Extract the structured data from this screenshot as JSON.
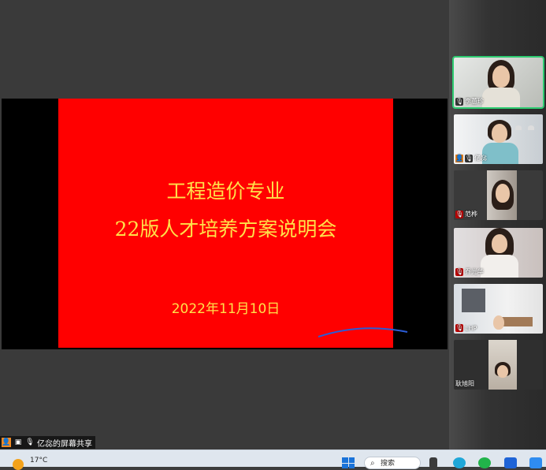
{
  "slide": {
    "title_line1": "工程造价专业",
    "title_line2": "22版人才培养方案说明会",
    "date": "2022年11月10日"
  },
  "participants": [
    {
      "name": "李蕙珍",
      "muted": false,
      "host": false,
      "active": true
    },
    {
      "name": "亿惢",
      "muted": false,
      "host": true,
      "active": false
    },
    {
      "name": "范桦",
      "muted": true,
      "host": false,
      "active": false
    },
    {
      "name": "乔光华",
      "muted": true,
      "host": false,
      "active": false
    },
    {
      "name": "LHP",
      "muted": true,
      "host": false,
      "active": false
    },
    {
      "name": "耿旭阳",
      "muted": false,
      "host": false,
      "active": false
    }
  ],
  "share_status": "亿惢的屏幕共享",
  "taskbar": {
    "temperature": "17°C",
    "search_label": "搜索"
  },
  "colors": {
    "slide_bg": "#ff0000",
    "slide_text": "#ffe14a",
    "active_speaker": "#2ecc71",
    "pen_stroke": "#2b5cd6"
  }
}
